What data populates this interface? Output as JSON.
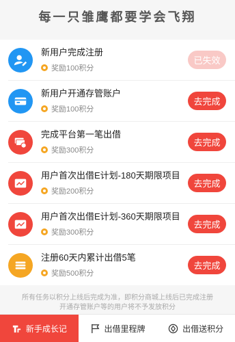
{
  "header": {
    "slogan": "每一只雏鹰都要学会飞翔"
  },
  "colors": {
    "accent": "#f0463c",
    "coin": "#f5a623",
    "blue_icon": "#2196f3",
    "red_icon": "#f0463c",
    "yellow_icon": "#f5a623"
  },
  "tasks": [
    {
      "title": "新用户完成注册",
      "reward": "奖励100积分",
      "button": "已失效",
      "status": "expired",
      "icon": "user-edit-icon"
    },
    {
      "title": "新用户开通存管账户",
      "reward": "奖励100积分",
      "button": "去完成",
      "status": "active",
      "icon": "card-icon"
    },
    {
      "title": "完成平台第一笔出借",
      "reward": "奖励300积分",
      "button": "去完成",
      "status": "active",
      "icon": "money-stack-icon"
    },
    {
      "title": "用户首次出借E计划-180天期限项目",
      "reward": "奖励200积分",
      "button": "去完成",
      "status": "active",
      "icon": "chart-icon"
    },
    {
      "title": "用户首次出借E计划-360天期限项目",
      "reward": "奖励300积分",
      "button": "去完成",
      "status": "active",
      "icon": "chart-icon"
    },
    {
      "title": "注册60天内累计出借5笔",
      "reward": "奖励500积分",
      "button": "去完成",
      "status": "active",
      "icon": "coin-stack-icon"
    }
  ],
  "notice": "所有任务以积分上线后完成为准，即积分商城上线后已完成注册开通存管账户等的用户将不予发放积分",
  "tabbar": [
    {
      "label": "新手成长记",
      "icon": "growth-icon",
      "active": true
    },
    {
      "label": "出借里程牌",
      "icon": "flag-icon",
      "active": false
    },
    {
      "label": "出借送积分",
      "icon": "points-icon",
      "active": false
    }
  ]
}
